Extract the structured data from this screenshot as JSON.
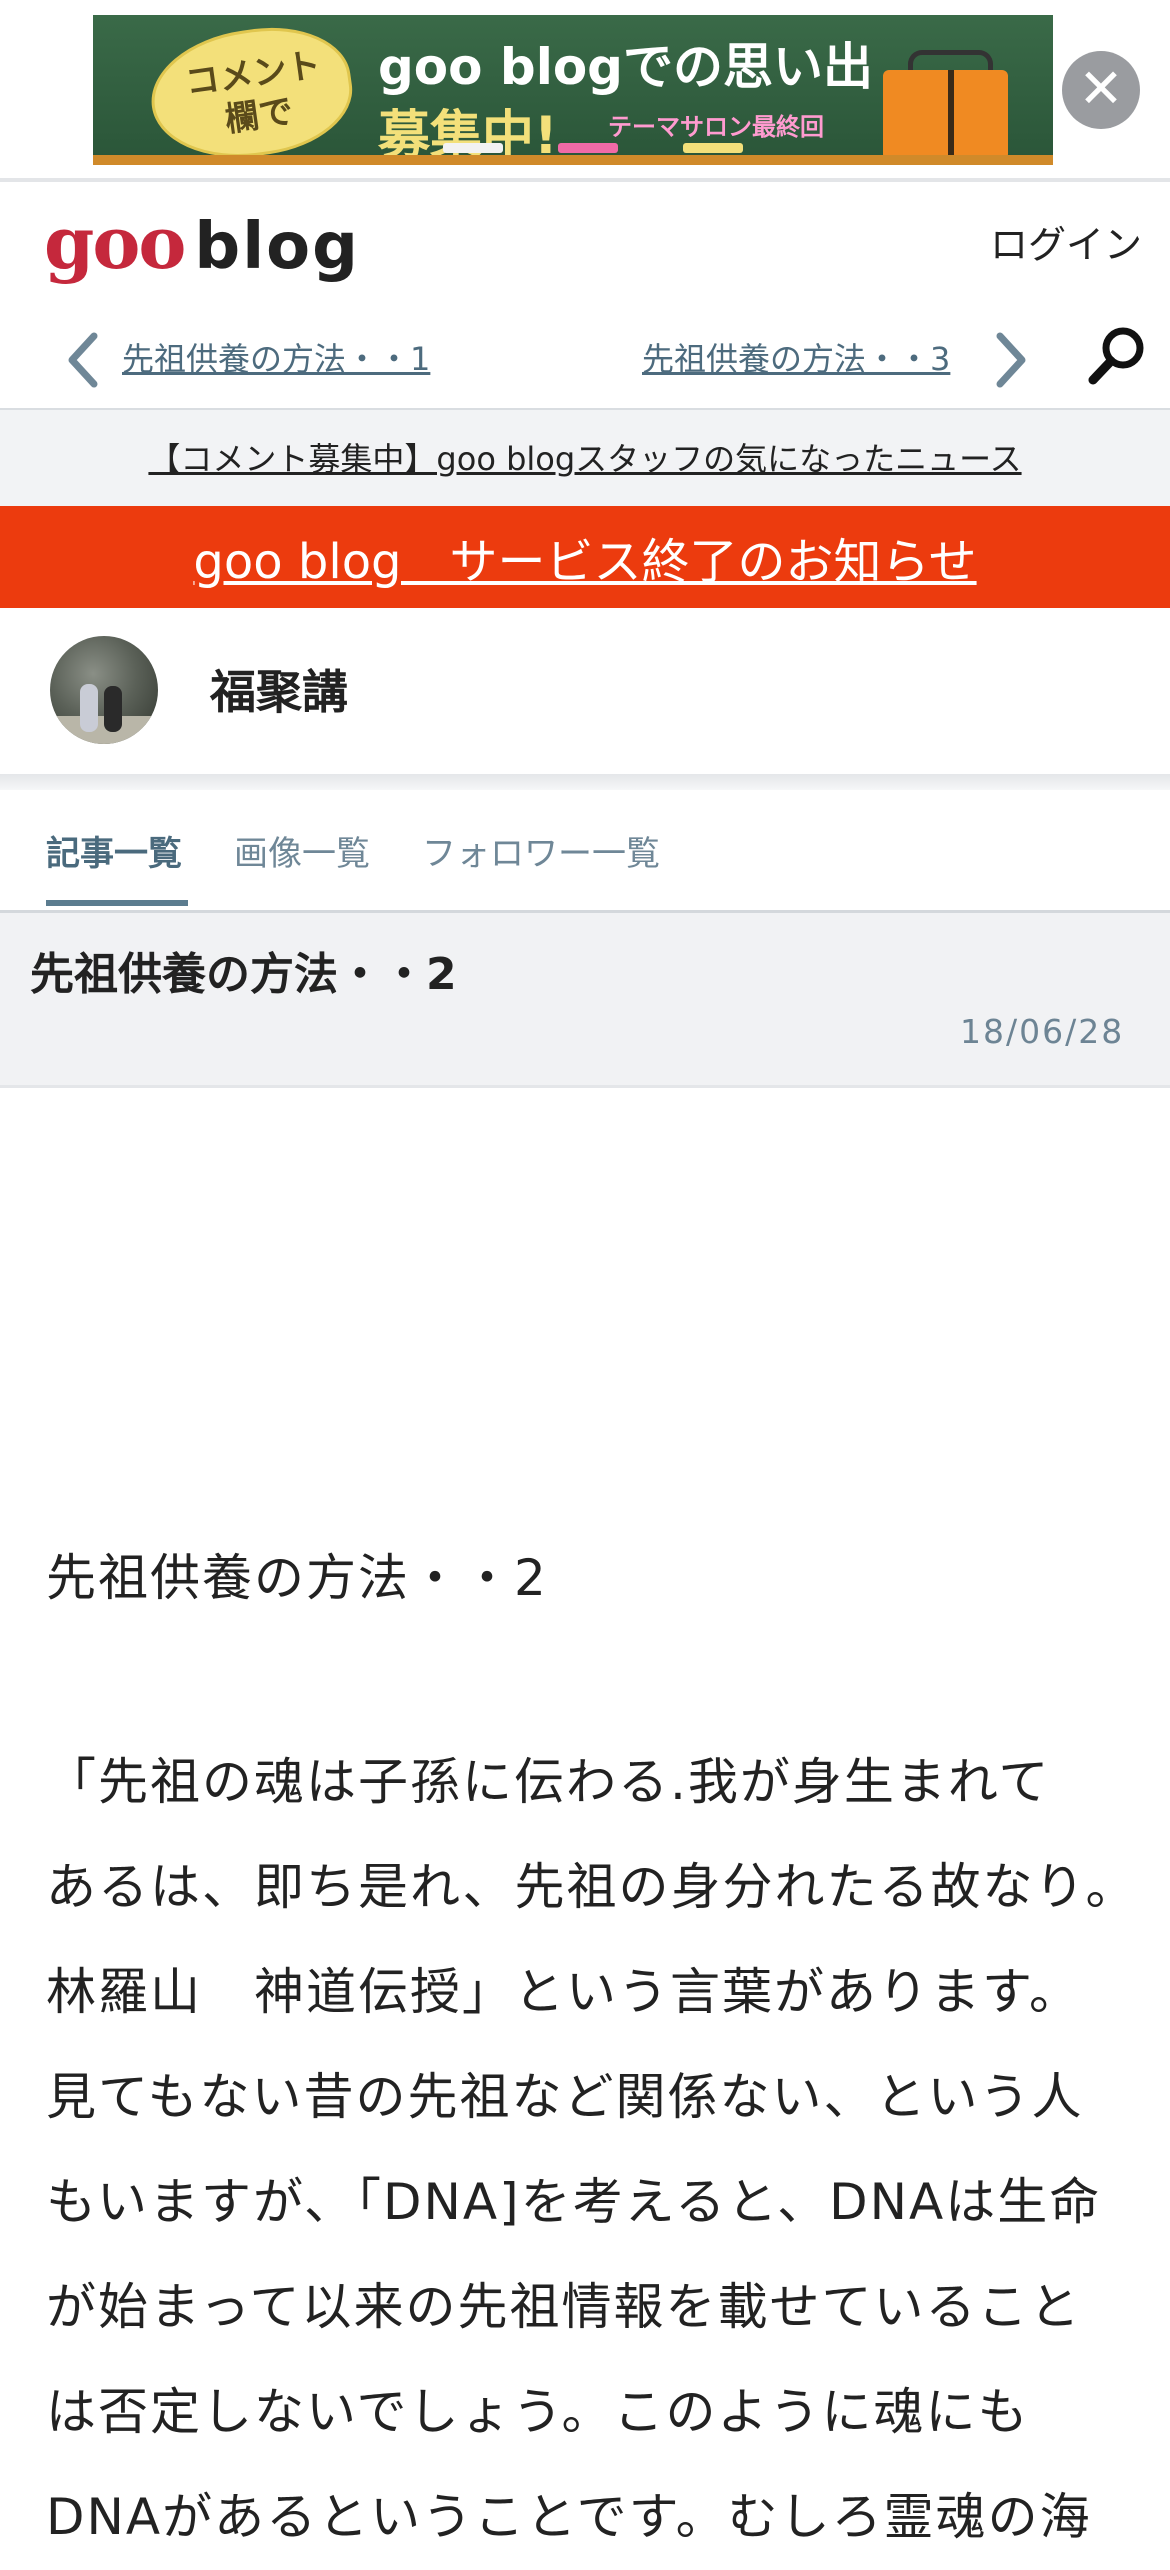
{
  "ad": {
    "bubble_text": "コメント\n欄で",
    "headline": "goo blogでの思い出",
    "subline": "募集中!",
    "tagline": "テーマサロン最終回",
    "close_symbol": "✕"
  },
  "header": {
    "logo_goo": "goo",
    "logo_blog": "blog",
    "login_label": "ログイン",
    "prev_post": "先祖供養の方法・・1",
    "next_post": "先祖供養の方法・・3"
  },
  "notice": {
    "text": "【コメント募集中】goo blogスタッフの気になったニュース"
  },
  "service_banner": {
    "text": "goo blog　サービス終了のお知らせ",
    "color": "#ec3b0e"
  },
  "profile": {
    "name": "福聚講"
  },
  "tabs": [
    {
      "label": "記事一覧",
      "active": true
    },
    {
      "label": "画像一覧",
      "active": false
    },
    {
      "label": "フォロワー一覧",
      "active": false
    }
  ],
  "article": {
    "title": "先祖供養の方法・・2",
    "date": "18/06/28",
    "body_title": "先祖供養の方法・・2",
    "lines": [
      "「先祖の魂は子孫に伝わる.我が身生まれて",
      "あるは、即ち是れ、先祖の身分れたる故なり。",
      "林羅山　神道伝授」という言葉があります。",
      "見てもない昔の先祖など関係ない、という人",
      "もいますが、「DNA]を考えると、DNAは生命",
      "が始まって以来の先祖情報を載せていること",
      "は否定しないでしょう。このように魂にも",
      "DNAがあるということです。むしろ霊魂の海"
    ]
  },
  "icons": {
    "prev": "chevron-left-icon",
    "next": "chevron-right-icon",
    "search": "search-icon",
    "close": "close-icon"
  }
}
